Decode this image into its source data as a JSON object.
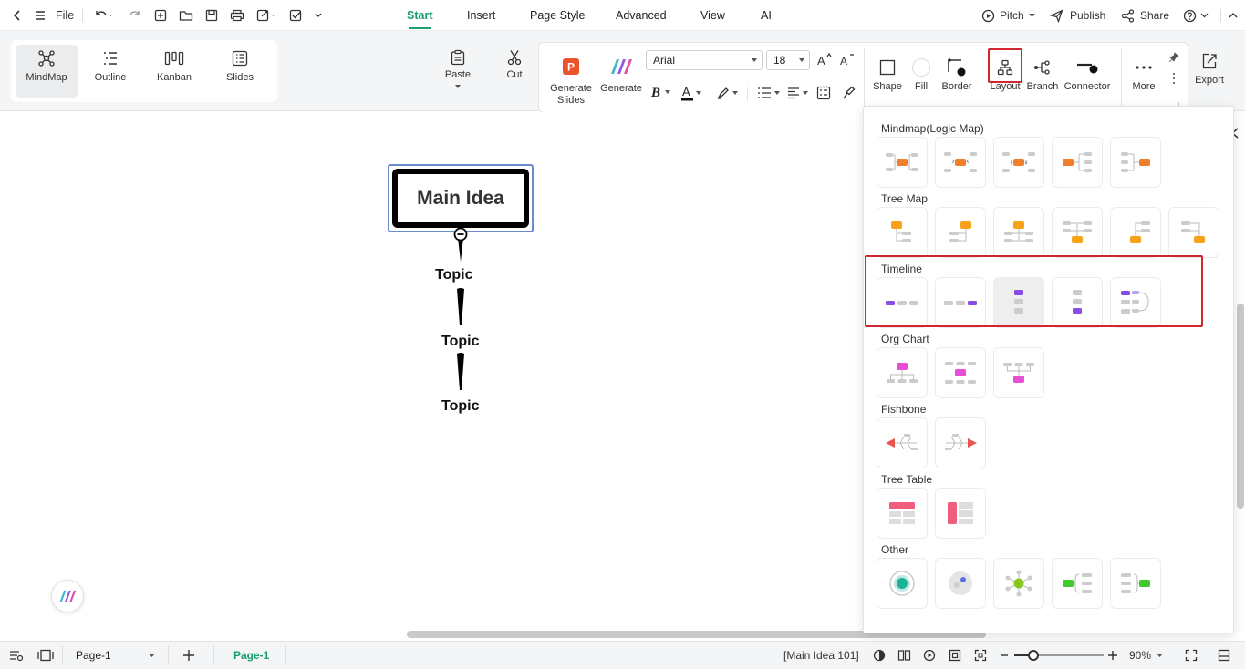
{
  "topbar": {
    "file_label": "File",
    "menu_tabs": [
      {
        "label": "Start"
      },
      {
        "label": "Insert"
      },
      {
        "label": "Page Style"
      },
      {
        "label": "Advanced"
      },
      {
        "label": "View"
      },
      {
        "label": "AI"
      }
    ],
    "active_tab": "Start",
    "pitch_label": "Pitch",
    "publish_label": "Publish",
    "share_label": "Share"
  },
  "ribbon": {
    "views": [
      {
        "label": "MindMap",
        "icon": "mindmap-icon"
      },
      {
        "label": "Outline",
        "icon": "outline-icon"
      },
      {
        "label": "Kanban",
        "icon": "kanban-icon"
      },
      {
        "label": "Slides",
        "icon": "slides-icon"
      }
    ],
    "paste_label": "Paste",
    "cut_label": "Cut",
    "generate_slides_label": "Generate Slides",
    "generate_label": "Generate",
    "font_family": "Arial",
    "font_size": "18",
    "shape_label": "Shape",
    "fill_label": "Fill",
    "border_label": "Border",
    "layout_label": "Layout",
    "branch_label": "Branch",
    "connector_label": "Connector",
    "more_label": "More",
    "export_label": "Export",
    "accent_color": "#1a9e6e",
    "highlight_color": "#d0262f"
  },
  "canvas": {
    "main_idea": "Main Idea",
    "topics": [
      "Topic",
      "Topic",
      "Topic"
    ]
  },
  "layout_panel": {
    "sections": [
      {
        "title": "Mindmap(Logic Map)",
        "count": 5
      },
      {
        "title": "Tree Map",
        "count": 6
      },
      {
        "title": "Timeline",
        "count": 5
      },
      {
        "title": "Org Chart",
        "count": 3
      },
      {
        "title": "Fishbone",
        "count": 2
      },
      {
        "title": "Tree Table",
        "count": 2
      },
      {
        "title": "Other",
        "count": 5
      }
    ],
    "highlighted_section": "Timeline"
  },
  "bottombar": {
    "page_select": "Page-1",
    "page_tab": "Page-1",
    "status": "[Main Idea 101]",
    "zoom": "90%"
  }
}
